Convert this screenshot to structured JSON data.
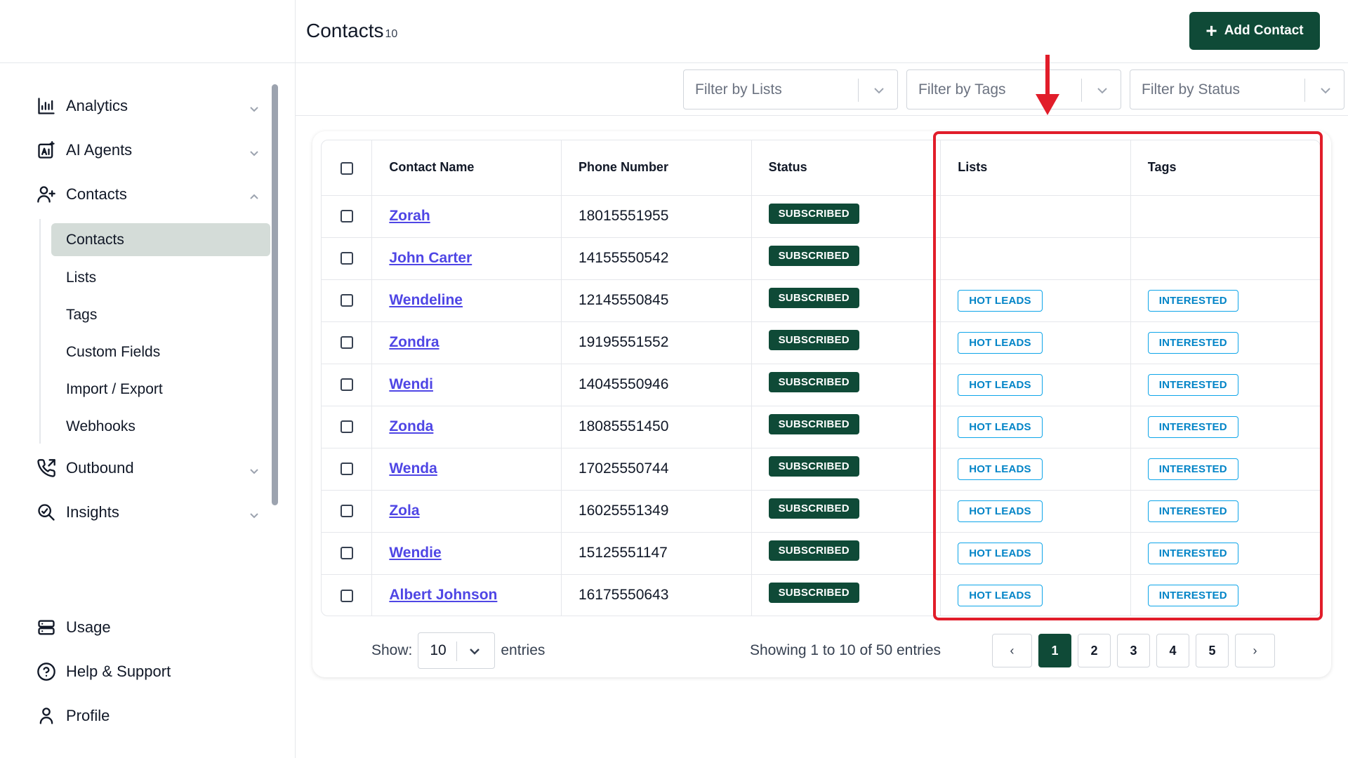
{
  "header": {
    "title": "Contacts",
    "count": "10",
    "add_button_label": "Add Contact"
  },
  "sidebar": {
    "groups": [
      {
        "label": "Analytics",
        "icon": "chart-icon"
      },
      {
        "label": "AI Agents",
        "icon": "ai-icon"
      },
      {
        "label": "Contacts",
        "icon": "user-plus-icon"
      },
      {
        "label": "Outbound",
        "icon": "phone-outgoing-icon"
      },
      {
        "label": "Insights",
        "icon": "insights-icon"
      },
      {
        "label": "Usage",
        "icon": "database-icon"
      },
      {
        "label": "Help & Support",
        "icon": "help-icon"
      },
      {
        "label": "Profile",
        "icon": "profile-icon"
      }
    ],
    "contacts_sub": [
      "Contacts",
      "Lists",
      "Tags",
      "Custom Fields",
      "Import / Export",
      "Webhooks"
    ],
    "active_sub": "Contacts"
  },
  "filters": {
    "lists_placeholder": "Filter by Lists",
    "tags_placeholder": "Filter by Tags",
    "status_placeholder": "Filter by Status"
  },
  "table": {
    "columns": [
      "Contact Name",
      "Phone Number",
      "Status",
      "Lists",
      "Tags"
    ],
    "rows": [
      {
        "name": "Zorah",
        "phone": "18015551955",
        "status": "SUBSCRIBED",
        "list": "",
        "tag": ""
      },
      {
        "name": "John Carter",
        "phone": "14155550542",
        "status": "SUBSCRIBED",
        "list": "",
        "tag": ""
      },
      {
        "name": "Wendeline",
        "phone": "12145550845",
        "status": "SUBSCRIBED",
        "list": "HOT LEADS",
        "tag": "INTERESTED"
      },
      {
        "name": "Zondra",
        "phone": "19195551552",
        "status": "SUBSCRIBED",
        "list": "HOT LEADS",
        "tag": "INTERESTED"
      },
      {
        "name": "Wendi",
        "phone": "14045550946",
        "status": "SUBSCRIBED",
        "list": "HOT LEADS",
        "tag": "INTERESTED"
      },
      {
        "name": "Zonda",
        "phone": "18085551450",
        "status": "SUBSCRIBED",
        "list": "HOT LEADS",
        "tag": "INTERESTED"
      },
      {
        "name": "Wenda",
        "phone": "17025550744",
        "status": "SUBSCRIBED",
        "list": "HOT LEADS",
        "tag": "INTERESTED"
      },
      {
        "name": "Zola",
        "phone": "16025551349",
        "status": "SUBSCRIBED",
        "list": "HOT LEADS",
        "tag": "INTERESTED"
      },
      {
        "name": "Wendie",
        "phone": "15125551147",
        "status": "SUBSCRIBED",
        "list": "HOT LEADS",
        "tag": "INTERESTED"
      },
      {
        "name": "Albert Johnson",
        "phone": "16175550643",
        "status": "SUBSCRIBED",
        "list": "HOT LEADS",
        "tag": "INTERESTED"
      }
    ]
  },
  "footer": {
    "show_label": "Show:",
    "show_value": "10",
    "entries_label": "entries",
    "showing_text": "Showing 1 to 10 of 50 entries",
    "prev": "‹",
    "next": "›",
    "pages": [
      "1",
      "2",
      "3",
      "4",
      "5"
    ],
    "current_page": "1"
  },
  "colors": {
    "brand_green": "#0f4a37",
    "link_blue": "#4f46e5",
    "tag_blue": "#0284c7",
    "annotation_red": "#e11d2a"
  }
}
